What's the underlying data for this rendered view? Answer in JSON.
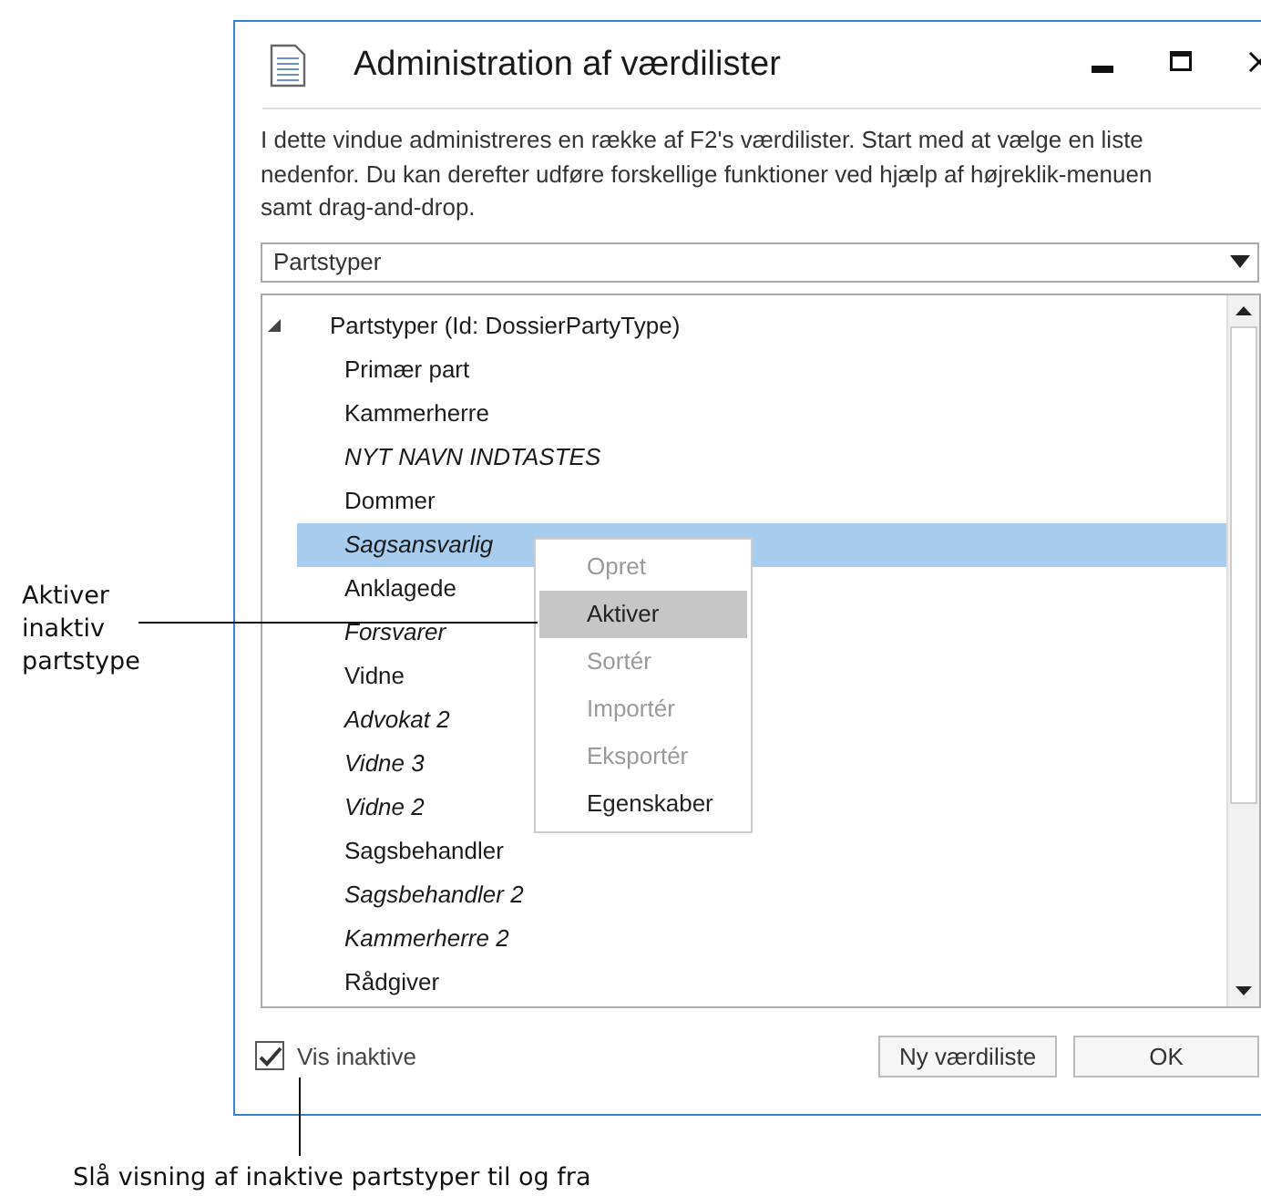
{
  "window": {
    "title": "Administration af værdilister",
    "description": "I dette vindue administreres en række af F2's værdilister. Start med at vælge en liste nedenfor. Du kan derefter udføre forskellige funktioner ved hjælp af højreklik-menuen samt drag-and-drop."
  },
  "list_select": {
    "value": "Partstyper"
  },
  "tree": {
    "label": "Partstyper (Id: DossierPartyType)",
    "expanded": true,
    "children": [
      {
        "label": "Primær part",
        "inactive": false,
        "selected": false
      },
      {
        "label": "Kammerherre",
        "inactive": false,
        "selected": false
      },
      {
        "label": "NYT NAVN INDTASTES",
        "inactive": true,
        "selected": false
      },
      {
        "label": "Dommer",
        "inactive": false,
        "selected": false
      },
      {
        "label": "Sagsansvarlig",
        "inactive": true,
        "selected": true
      },
      {
        "label": "Anklagede",
        "inactive": false,
        "selected": false
      },
      {
        "label": "Forsvarer",
        "inactive": true,
        "selected": false
      },
      {
        "label": "Vidne",
        "inactive": false,
        "selected": false
      },
      {
        "label": "Advokat 2",
        "inactive": true,
        "selected": false
      },
      {
        "label": "Vidne 3",
        "inactive": true,
        "selected": false
      },
      {
        "label": "Vidne 2",
        "inactive": true,
        "selected": false
      },
      {
        "label": "Sagsbehandler",
        "inactive": false,
        "selected": false
      },
      {
        "label": "Sagsbehandler 2",
        "inactive": true,
        "selected": false
      },
      {
        "label": "Kammerherre 2",
        "inactive": true,
        "selected": false
      },
      {
        "label": "Rådgiver",
        "inactive": false,
        "selected": false
      }
    ]
  },
  "context_menu": [
    {
      "label": "Opret",
      "disabled": true,
      "highlighted": false
    },
    {
      "label": "Aktiver",
      "disabled": false,
      "highlighted": true
    },
    {
      "label": "Sortér",
      "disabled": true,
      "highlighted": false
    },
    {
      "label": "Importér",
      "disabled": true,
      "highlighted": false
    },
    {
      "label": "Eksportér",
      "disabled": true,
      "highlighted": false
    },
    {
      "label": "Egenskaber",
      "disabled": false,
      "highlighted": false
    }
  ],
  "show_inactive": {
    "label": "Vis inaktive",
    "checked": true
  },
  "buttons": [
    "Ny værdiliste",
    "OK"
  ],
  "callouts": [
    "Aktiver inaktiv partstype",
    "Slå visning af inaktive partstyper til og fra"
  ]
}
